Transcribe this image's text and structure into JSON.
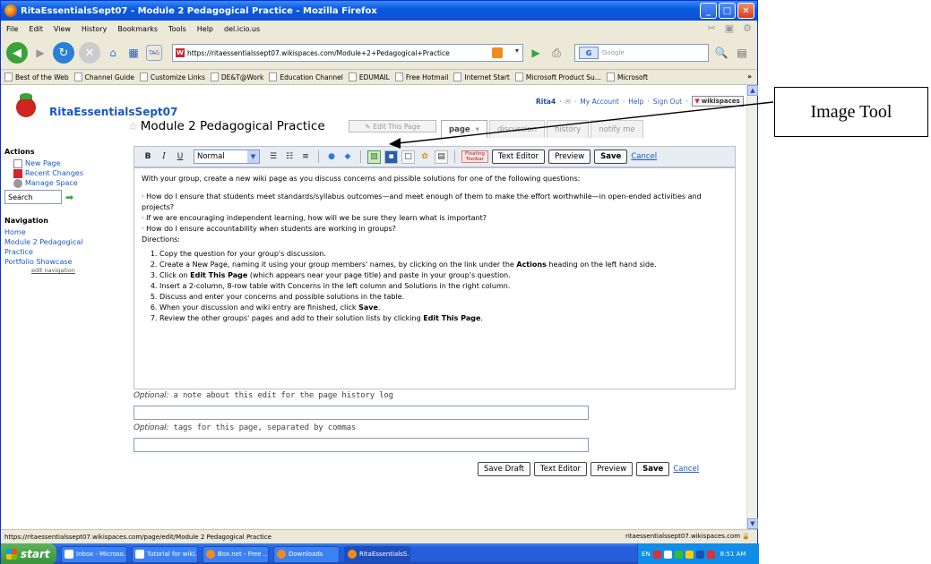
{
  "window": {
    "title": "RitaEssentialsSept07 - Module 2 Pedagogical Practice - Mozilla Firefox",
    "btn_min": "_",
    "btn_max": "□",
    "btn_close": "✕"
  },
  "menubar": [
    "File",
    "Edit",
    "View",
    "History",
    "Bookmarks",
    "Tools",
    "Help",
    "del.icio.us"
  ],
  "navbar": {
    "url": "https://ritaessentialssept07.wikispaces.com/Module+2+Pedagogical+Practice",
    "search_placeholder": "Google",
    "tag_label": "TAG"
  },
  "bookmarks": {
    "items": [
      "Best of the Web",
      "Channel Guide",
      "Customize Links",
      "DE&T@Work",
      "Education Channel",
      "EDUMAIL",
      "Free Hotmail",
      "Internet Start",
      "Microsoft Product Su...",
      "Microsoft"
    ],
    "more": "»"
  },
  "page": {
    "space_name": "RitaEssentialsSept07",
    "user": "Rita4",
    "my_account": "My Account",
    "help": "Help",
    "sign_out": "Sign Out",
    "wikispaces_badge": "wikispaces",
    "sep": "·",
    "title": "Module 2 Pedagogical Practice",
    "edit_this_page": "Edit This Page",
    "tabs": [
      "page",
      "discussion",
      "history",
      "notify me"
    ]
  },
  "sidebar": {
    "actions_heading": "Actions",
    "actions": [
      "New Page",
      "Recent Changes",
      "Manage Space"
    ],
    "search_value": "Search",
    "navigation_heading": "Navigation",
    "nav_items": [
      "Home",
      "Module 2 Pedagogical Practice",
      "Portfolio Showcase"
    ],
    "edit_navigation": "edit navigation"
  },
  "editor": {
    "bold": "B",
    "italic": "I",
    "underline": "U",
    "format": "Normal",
    "floating_toolbar": "Floating Toolbar",
    "text_editor": "Text Editor",
    "preview": "Preview",
    "save": "Save",
    "cancel": "Cancel",
    "intro": "With your group, create a new wiki page as you discuss concerns and pissible solutions for one of the following questions:",
    "q1": "· How do I ensure that students meet standards/syllabus outcomes—and meet enough of them to make the effort worthwhile—in open-ended activities and projects?",
    "q2": "· If we are encouraging independent learning, how will we be sure they learn what is important?",
    "q3": "· How do I ensure accountability when students are working in groups?",
    "directions": "Directions:",
    "steps": [
      {
        "pre": "Copy the question for your group's discussion.",
        "b": "",
        "post": ""
      },
      {
        "pre": "Create a New Page, naming it using your group members' names, by clicking on the link under the ",
        "b": "Actions",
        "post": " heading on the left hand side."
      },
      {
        "pre": "Click on ",
        "b": "Edit This Page",
        "post": " (which appears near your page title) and paste in your group's question."
      },
      {
        "pre": "Insert a 2-column, 8-row table with Concerns in the left column and Solutions in the right column.",
        "b": "",
        "post": ""
      },
      {
        "pre": "Discuss and enter your concerns and possible solutions in the table.",
        "b": "",
        "post": ""
      },
      {
        "pre": "When your discussion and wiki entry are finished, click ",
        "b": "Save",
        "post": "."
      },
      {
        "pre": "Review the other groups' pages and add to their solution lists by clicking ",
        "b": "Edit This Page",
        "post": "."
      }
    ]
  },
  "optional": {
    "note_prefix": "Optional:",
    "note_label": " a note about this edit for the page history log",
    "tags_prefix": "Optional:",
    "tags_label": " tags for this page, separated by commas"
  },
  "bottom": {
    "save_draft": "Save Draft",
    "text_editor": "Text Editor",
    "preview": "Preview",
    "save": "Save",
    "cancel": "Cancel"
  },
  "statusbar": {
    "left": "https://ritaessentialssept07.wikispaces.com/page/edit/Module 2 Pedagogical Practice",
    "right": "ritaessentialssept07.wikispaces.com"
  },
  "taskbar": {
    "start": "start",
    "tasks": [
      "Inbox - Microso...",
      "Tutorial for wiki...",
      "Box.net - Free ...",
      "Downloads",
      "RitaEssentialsS..."
    ],
    "lang": "EN",
    "time": "8:51 AM"
  },
  "annotation": {
    "callout": "Image Tool"
  }
}
